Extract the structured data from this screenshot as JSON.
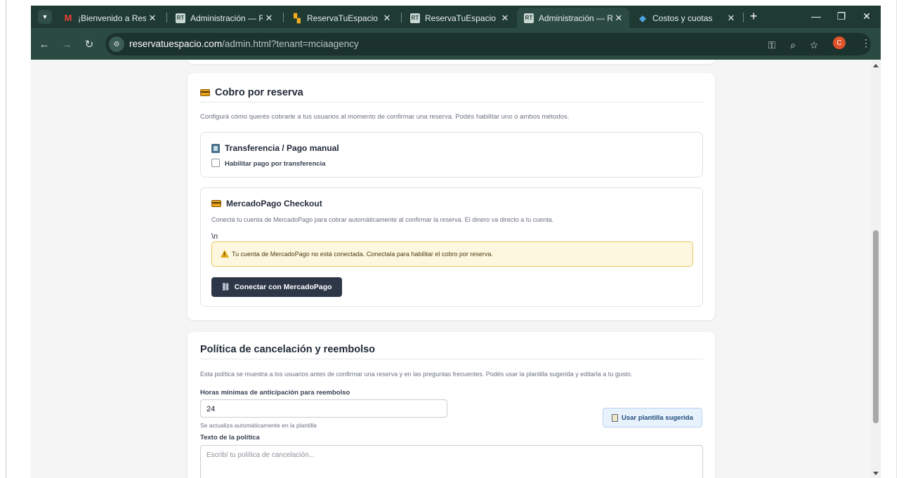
{
  "browser": {
    "tabs": [
      {
        "title": "¡Bienvenido a Reserva",
        "favicon": "M",
        "favicon_icon": "gmail-icon"
      },
      {
        "title": "Administración — Re",
        "favicon": "RT",
        "favicon_icon": "app-icon"
      },
      {
        "title": "ReservaTuEspacio",
        "favicon": "▚",
        "favicon_icon": "grid-icon"
      },
      {
        "title": "ReservaTuEspacio",
        "favicon": "RT",
        "favicon_icon": "app-icon"
      },
      {
        "title": "Administración — Re",
        "favicon": "RT",
        "favicon_icon": "app-icon",
        "active": true
      },
      {
        "title": "Costos y cuotas",
        "favicon": "◆",
        "favicon_icon": "globe-icon"
      }
    ],
    "close_glyph": "✕",
    "new_tab_glyph": "+",
    "url_host": "reservatuespacio.com",
    "url_path": "/admin.html?tenant=mciaagency",
    "profile_initial": "C"
  },
  "cobro": {
    "title": "Cobro por reserva",
    "description": "Configurá cómo querés cobrarle a tus usuarios al momento de confirmar una reserva. Podés habilitar uno o ambos métodos.",
    "transferencia": {
      "title": "Transferencia / Pago manual",
      "checkbox_label": "Habilitar pago por transferencia",
      "checked": false
    },
    "mercadopago": {
      "title": "MercadoPago Checkout",
      "description": "Conectá tu cuenta de MercadoPago para cobrar automáticamente al confirmar la reserva. El dinero va directo a tu cuenta.",
      "stray_text": "\\n",
      "warning": "Tu cuenta de MercadoPago no está conectada. Conectala para habilitar el cobro por reserva.",
      "connect_button": "Conectar con MercadoPago"
    }
  },
  "politica": {
    "title": "Política de cancelación y reembolso",
    "description": "Esta política se muestra a los usuarios antes de confirmar una reserva y en las preguntas frecuentes. Podés usar la plantilla sugerida y editarla a tu gusto.",
    "hours_label": "Horas mínimas de anticipación para reembolso",
    "hours_value": "24",
    "hours_hint": "Se actualiza automáticamente en la plantilla",
    "template_button": "Usar plantilla sugerida",
    "text_label": "Texto de la política",
    "text_placeholder": "Escribí tu política de cancelación..."
  },
  "colors": {
    "tabstrip": "#1e3a33",
    "toolbar": "#2b4a42",
    "dark_button": "#2d3748",
    "warning_bg": "#fef7e0",
    "warning_border": "#e8c45a"
  }
}
